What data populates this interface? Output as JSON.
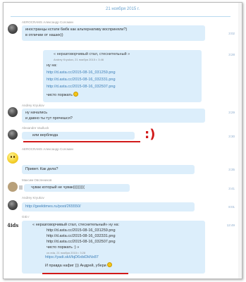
{
  "date_header": "21 ноября 2015 г.",
  "messages": [
    {
      "author": "AEROCRAMS Александр Соломин",
      "time": "3:02",
      "lines": [
        "иностранцы кстати 6мбк как альтернативу восприняли?)",
        "в отличии от наших))"
      ]
    },
    {
      "time": "3:28",
      "quote_head": "« неразговорчивый стал, стеснительный »",
      "quote_meta": "Andrey Kryukov, 21 ноября 2015 г. 3:46",
      "lines": [
        "ну на:",
        "http://d.asta.cc/2015-08-16_031259.png",
        "http://d.asta.cc/2015-08-16_032331.png",
        "http://d.asta.cc/2015-08-16_032507.png",
        "чисто поржать"
      ]
    },
    {
      "author": "Andrey Kryukov",
      "time": "3:29",
      "lines": [
        "ну начались",
        "и давно ты тут прячешся?"
      ]
    },
    {
      "author": "Alexandre Vaulluck",
      "time": "3:30",
      "lines": [
        "или верблюда"
      ],
      "mark": ":)"
    },
    {
      "author": "AEROCRAMS Александр Соломин",
      "time": "3:35",
      "lines": [
        "Привет. Как дела?"
      ]
    },
    {
      "author": "Максим Овсянников",
      "time": "3:41",
      "lines": [
        "чувак который не чувак((((((((("
      ]
    },
    {
      "author": "Andrey Kryukov",
      "time": "8:01",
      "lines": [
        "http://geektimes.ru/post/265550/"
      ]
    },
    {
      "author": "GID r",
      "avatar_text": "4ids",
      "time": "12:49",
      "quote_head": "« неразговорчивый стал, стеснительный» ну на:",
      "quote_lines": [
        "http://d.asta.cc/2015-08-16_031259.png",
        "http://d.asta.cc/2015-08-16_032331.png",
        "http://d.asta.cc/2015-08-16_032507.png",
        "чисто поржать :) »"
      ],
      "quote_meta": "cn.eda, 21 ноября 2015 г. 3:28",
      "lines": [
        "https://yadi.sk/i/lqD6xbiDkNx87",
        "И правда нафиг ))) Андрей, убери"
      ]
    }
  ],
  "colors": {
    "bubble": "#dceefb",
    "link": "#3d7fb8",
    "accent_red": "#d11a1a",
    "date": "#6aa3cf"
  }
}
